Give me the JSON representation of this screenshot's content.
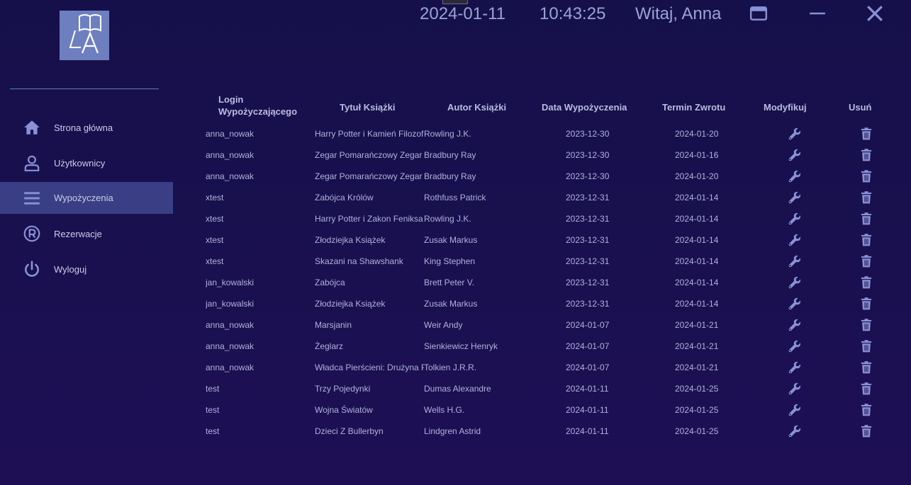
{
  "header": {
    "date": "2024-01-11",
    "time": "10:43:25",
    "greeting": "Witaj, Anna"
  },
  "logo": {
    "text": "LA"
  },
  "sidebar": {
    "items": [
      {
        "label": "Strona główna",
        "icon": "home-icon",
        "active": false
      },
      {
        "label": "Użytkownicy",
        "icon": "user-icon",
        "active": false
      },
      {
        "label": "Wypożyczenia",
        "icon": "menu-icon",
        "active": true
      },
      {
        "label": "Rezerwacje",
        "icon": "registered-icon",
        "active": false
      },
      {
        "label": "Wyloguj",
        "icon": "power-icon",
        "active": false
      }
    ]
  },
  "table": {
    "headers": {
      "login_line1": "Login",
      "login_line2": "Wypożyczającego",
      "title": "Tytuł Książki",
      "author": "Autor Książki",
      "loan_date": "Data Wypożyczenia",
      "return_date": "Termin Zwrotu",
      "modify": "Modyfikuj",
      "delete": "Usuń"
    },
    "rows": [
      {
        "login": "anna_nowak",
        "title": "Harry Potter i Kamień Filozoficzny",
        "author": "Rowling J.K.",
        "loan": "2023-12-30",
        "due": "2024-01-20"
      },
      {
        "login": "anna_nowak",
        "title": "Zegar Pomarańczowy Zegar Skręcony",
        "author": "Bradbury Ray",
        "loan": "2023-12-30",
        "due": "2024-01-16"
      },
      {
        "login": "anna_nowak",
        "title": "Zegar Pomarańczowy Zegar Skręcony",
        "author": "Bradbury Ray",
        "loan": "2023-12-30",
        "due": "2024-01-20"
      },
      {
        "login": "xtest",
        "title": "Zabójca Królów",
        "author": "Rothfuss Patrick",
        "loan": "2023-12-31",
        "due": "2024-01-14"
      },
      {
        "login": "xtest",
        "title": "Harry Potter i Zakon Feniksa",
        "author": "Rowling J.K.",
        "loan": "2023-12-31",
        "due": "2024-01-14"
      },
      {
        "login": "xtest",
        "title": "Złodziejka Książek",
        "author": "Zusak Markus",
        "loan": "2023-12-31",
        "due": "2024-01-14"
      },
      {
        "login": "xtest",
        "title": "Skazani na Shawshank",
        "author": "King Stephen",
        "loan": "2023-12-31",
        "due": "2024-01-14"
      },
      {
        "login": "jan_kowalski",
        "title": "Zabójca",
        "author": "Brett Peter V.",
        "loan": "2023-12-31",
        "due": "2024-01-14"
      },
      {
        "login": "jan_kowalski",
        "title": "Złodziejka Książek",
        "author": "Zusak Markus",
        "loan": "2023-12-31",
        "due": "2024-01-14"
      },
      {
        "login": "anna_nowak",
        "title": "Marsjanin",
        "author": "Weir Andy",
        "loan": "2024-01-07",
        "due": "2024-01-21"
      },
      {
        "login": "anna_nowak",
        "title": "Żeglarz",
        "author": "Sienkiewicz Henryk",
        "loan": "2024-01-07",
        "due": "2024-01-21"
      },
      {
        "login": "anna_nowak",
        "title": "Władca Pierścieni: Drużyna Pierścienia",
        "author": "Tolkien J.R.R.",
        "loan": "2024-01-07",
        "due": "2024-01-21"
      },
      {
        "login": "test",
        "title": "Trzy Pojedynki",
        "author": "Dumas Alexandre",
        "loan": "2024-01-11",
        "due": "2024-01-25"
      },
      {
        "login": "test",
        "title": "Wojna Światów",
        "author": "Wells H.G.",
        "loan": "2024-01-11",
        "due": "2024-01-25"
      },
      {
        "login": "test",
        "title": "Dzieci Z Bullerbyn",
        "author": "Lindgren Astrid",
        "loan": "2024-01-11",
        "due": "2024-01-25"
      }
    ]
  },
  "colors": {
    "background": "#16104a",
    "sidebar_active": "#3a3f85",
    "icon": "#8a92d6",
    "text": "#aeb3da"
  }
}
